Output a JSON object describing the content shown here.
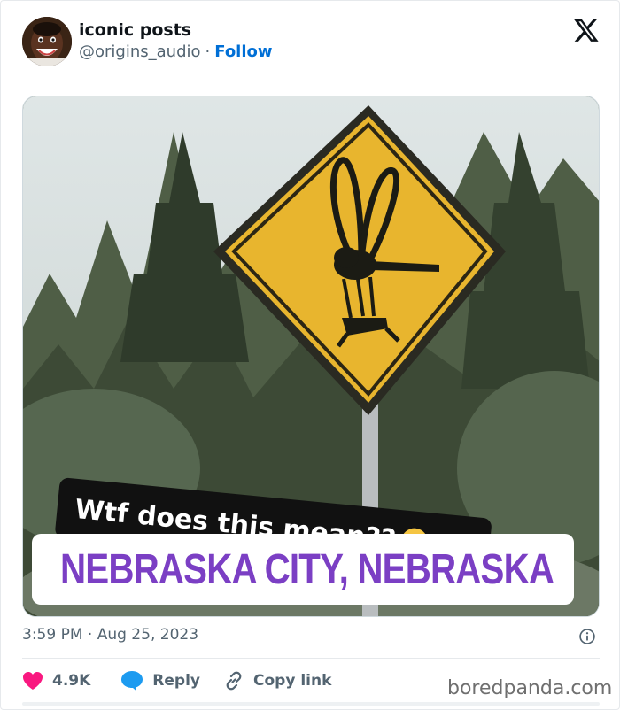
{
  "tweet": {
    "display_name": "iconic posts",
    "handle": "@origins_audio",
    "separator": "·",
    "follow_label": "Follow",
    "timestamp": "3:59 PM · Aug 25, 2023",
    "image": {
      "caption": "Wtf does this mean??",
      "caption_emoji": "loudly-crying-face-emoji",
      "location": "NEBRASKA CITY, NEBRASKA"
    },
    "actions": {
      "like_count": "4.9K",
      "reply_label": "Reply",
      "copy_link_label": "Copy link"
    }
  },
  "watermark": "boredpanda.com",
  "icons": {
    "brand": "x-logo-icon",
    "info": "info-icon",
    "like": "heart-icon",
    "reply": "speech-bubble-icon",
    "copy": "link-icon",
    "location": "map-pin-icon"
  },
  "colors": {
    "follow_link": "#006fd6",
    "like_heart": "#f91880",
    "reply_bubble": "#1d9bf0",
    "location_text": "#7b3fc4",
    "sign_yellow": "#e8b52e",
    "muted_text": "#536471"
  }
}
